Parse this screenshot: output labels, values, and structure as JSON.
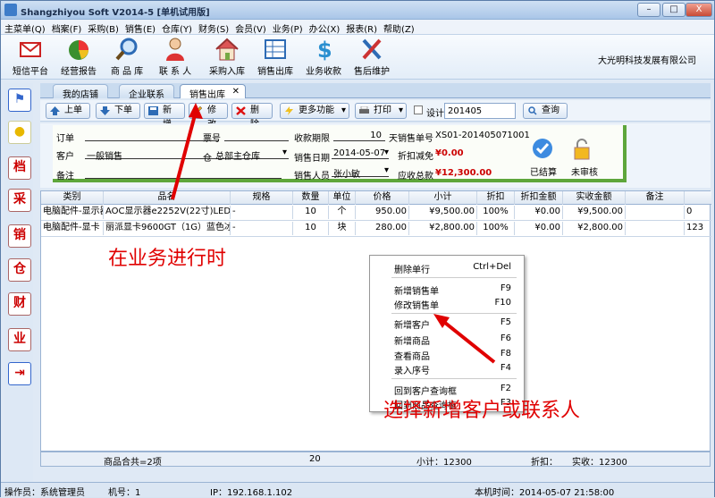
{
  "title": "Shangzhiyou Soft V2014-5 [单机试用版]",
  "window_buttons": [
    "–",
    "□",
    "X"
  ],
  "menu": [
    "主菜单(Q)",
    "档案(F)",
    "采购(B)",
    "销售(E)",
    "仓库(Y)",
    "财务(S)",
    "会员(V)",
    "业务(P)",
    "办公(X)",
    "报表(R)",
    "帮助(Z)"
  ],
  "toolbar": [
    {
      "label": "短信平台",
      "icon": "envelope-icon"
    },
    {
      "label": "经营报告",
      "icon": "pie-chart-icon"
    },
    {
      "label": "商 品 库",
      "icon": "magnifier-icon"
    },
    {
      "label": "联 系 人",
      "icon": "person-icon"
    },
    {
      "label": "采购入库",
      "icon": "house-icon"
    },
    {
      "label": "销售出库",
      "icon": "grid-icon"
    },
    {
      "label": "业务收款",
      "icon": "dollar-icon"
    },
    {
      "label": "售后维护",
      "icon": "tools-icon"
    }
  ],
  "company": "大光明科技发展有限公司",
  "sidebar": [
    "flag-icon",
    "bulb-icon",
    "档",
    "采",
    "销",
    "仓",
    "财",
    "业",
    "exit-icon"
  ],
  "tabs": [
    "我的店铺",
    "企业联系",
    "销售出库"
  ],
  "tab_close": "✕",
  "actions": {
    "up": "上单",
    "down": "下单",
    "new": "新增",
    "edit": "修改",
    "delete": "删除",
    "more": "更多功能",
    "print": "打印",
    "design": "设计",
    "period": "201405",
    "query": "查询"
  },
  "form": {
    "order_label": "订单",
    "customer_label": "客户",
    "customer_value": "一般销售",
    "note_label": "备注",
    "ticket_label": "票号",
    "warehouse_label": "仓",
    "warehouse_value": "总部主仓库",
    "term_label": "收款期限",
    "term_value": "10",
    "term_unit": "天",
    "date_label": "销售日期",
    "date_value": "2014-05-07",
    "person_label": "销售人员",
    "person_value": "张小敏",
    "no_label": "销售单号",
    "no_value": "XS01-201405071001",
    "discount_label": "折扣减免",
    "discount_value": "¥0.00",
    "total_label": "应收总款",
    "total_value": "¥12,300.00",
    "settled": "已结算",
    "unaudited": "未审核"
  },
  "columns": [
    "类别",
    "品名",
    "规格",
    "数量",
    "单位",
    "价格",
    "小计",
    "折扣",
    "折扣金额",
    "实收金额",
    "备注"
  ],
  "rows": [
    [
      "电脑配件-显示器",
      "AOC显示器e2252V(22寸)LED",
      "-",
      "10",
      "个",
      "950.00",
      "¥9,500.00",
      "100%",
      "¥0.00",
      "¥9,500.00",
      "",
      "0"
    ],
    [
      "电脑配件-显卡",
      "丽派显卡9600GT（1G）蓝色冰刃",
      "-",
      "10",
      "块",
      "280.00",
      "¥2,800.00",
      "100%",
      "¥0.00",
      "¥2,800.00",
      "",
      "123"
    ]
  ],
  "context_menu": [
    {
      "label": "删除单行",
      "key": "Ctrl+Del"
    },
    {
      "label": "新增销售单",
      "key": "F9"
    },
    {
      "label": "修改销售单",
      "key": "F10"
    },
    {
      "label": "新增客户",
      "key": "F5"
    },
    {
      "label": "新增商品",
      "key": "F6"
    },
    {
      "label": "查看商品",
      "key": "F8"
    },
    {
      "label": "录入序号",
      "key": "F4"
    },
    {
      "label": "回到客户查询框",
      "key": "F2"
    },
    {
      "label": "回到商品查询框",
      "key": "F3"
    }
  ],
  "footer": {
    "summary": "商品合共=2项",
    "qty": "20",
    "subtotal": "小计：12300",
    "discount": "折扣：",
    "received": "实收：12300"
  },
  "status": {
    "operator": "操作员：系统管理员",
    "machine": "机号：1",
    "ip": "IP：192.168.1.102",
    "time": "本机时间：2014-05-07 21:58:00"
  },
  "annotations": {
    "a1": "在业务进行时",
    "a2": "选择新增客户或联系人"
  },
  "colors": {
    "annotation": "#e00000",
    "accent": "#5ea63b",
    "titlebar": "#a9c6e8"
  }
}
